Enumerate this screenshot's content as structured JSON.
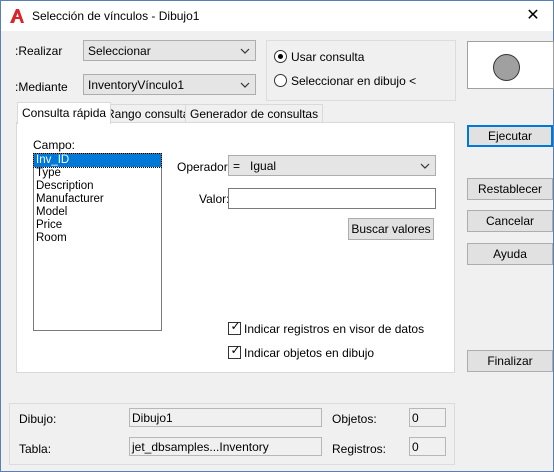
{
  "window": {
    "title": "Selección de vínculos - Dibujo1",
    "close": "✕"
  },
  "top": {
    "realizar_label": ":Realizar",
    "realizar_value": "Seleccionar",
    "mediante_label": ":Mediante",
    "mediante_value": "InventoryVínculo1",
    "radio_usar": "Usar consulta",
    "radio_seleccionar": "Seleccionar en dibujo <",
    "radio_selected": "usar"
  },
  "tabs": [
    {
      "label": "Consulta rápida",
      "active": true
    },
    {
      "label": "Rango consulta",
      "active": false
    },
    {
      "label": "Generador de consultas",
      "active": false
    }
  ],
  "quick": {
    "campo_label": "Campo:",
    "fields": [
      "Inv_ID",
      "Type",
      "Description",
      "Manufacturer",
      "Model",
      "Price",
      "Room"
    ],
    "selected_field": "Inv_ID",
    "operador_label": "Operador:",
    "operador_value": "=   Igual",
    "valor_label": "Valor:",
    "valor_value": "",
    "buscar_button": "Buscar valores",
    "check_registros": "Indicar registros en visor de datos",
    "check_objetos": "Indicar objetos en dibujo"
  },
  "buttons": {
    "ejecutar": "Ejecutar",
    "restablecer": "Restablecer",
    "cancelar": "Cancelar",
    "ayuda": "Ayuda",
    "finalizar": "Finalizar"
  },
  "status": {
    "dibujo_label": "Dibujo:",
    "dibujo_value": "Dibujo1",
    "objetos_label": "Objetos:",
    "objetos_value": "0",
    "tabla_label": "Tabla:",
    "tabla_value": "jet_dbsamples...Inventory",
    "registros_label": "Registros:",
    "registros_value": "0"
  },
  "colors": {
    "accent": "#0078d7",
    "app_icon": "#d9242c"
  }
}
